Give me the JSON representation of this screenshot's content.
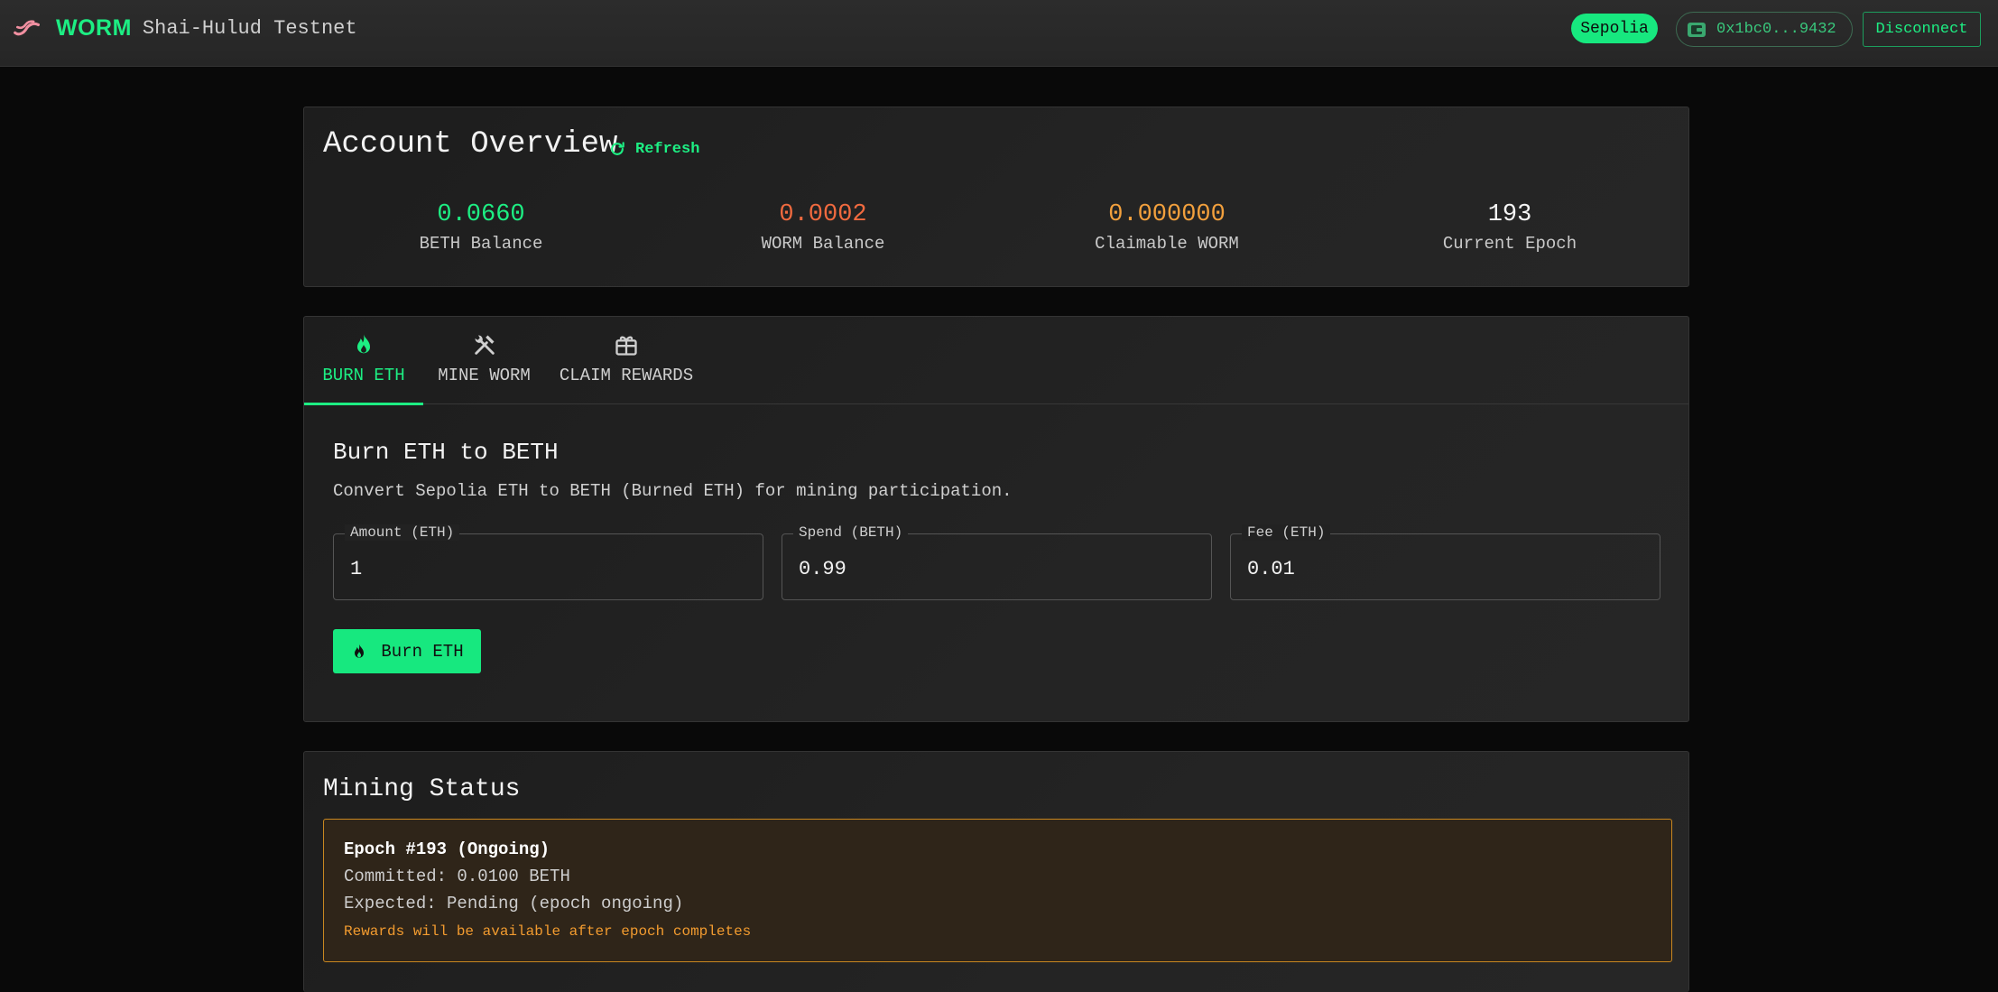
{
  "header": {
    "brand_name": "WORM",
    "subtitle": "Shai-Hulud Testnet",
    "network": "Sepolia",
    "wallet_address": "0x1bc0...9432",
    "disconnect_label": "Disconnect"
  },
  "overview": {
    "title": "Account Overview",
    "refresh_label": "Refresh",
    "stats": [
      {
        "value": "0.0660",
        "label": "BETH Balance"
      },
      {
        "value": "0.0002",
        "label": "WORM Balance"
      },
      {
        "value": "0.000000",
        "label": "Claimable WORM"
      },
      {
        "value": "193",
        "label": "Current Epoch"
      }
    ]
  },
  "tabs": [
    {
      "label": "BURN ETH",
      "icon": "flame-icon",
      "active": true
    },
    {
      "label": "MINE WORM",
      "icon": "tools-icon",
      "active": false
    },
    {
      "label": "CLAIM REWARDS",
      "icon": "gift-icon",
      "active": false
    }
  ],
  "burn": {
    "title": "Burn ETH to BETH",
    "description": "Convert Sepolia ETH to BETH (Burned ETH) for mining participation.",
    "fields": [
      {
        "label": "Amount (ETH)",
        "value": "1"
      },
      {
        "label": "Spend (BETH)",
        "value": "0.99"
      },
      {
        "label": "Fee (ETH)",
        "value": "0.01"
      }
    ],
    "button_label": "Burn ETH"
  },
  "mining": {
    "title": "Mining Status",
    "epoch_heading": "Epoch #193 (Ongoing)",
    "committed": "Committed: 0.0100 BETH",
    "expected": "Expected: Pending (epoch ongoing)",
    "note": "Rewards will be available after epoch completes"
  },
  "colors": {
    "accent": "#1dee83",
    "worm_balance": "#f06a3f",
    "claimable": "#f2a03d",
    "warning_border": "#c98720"
  }
}
